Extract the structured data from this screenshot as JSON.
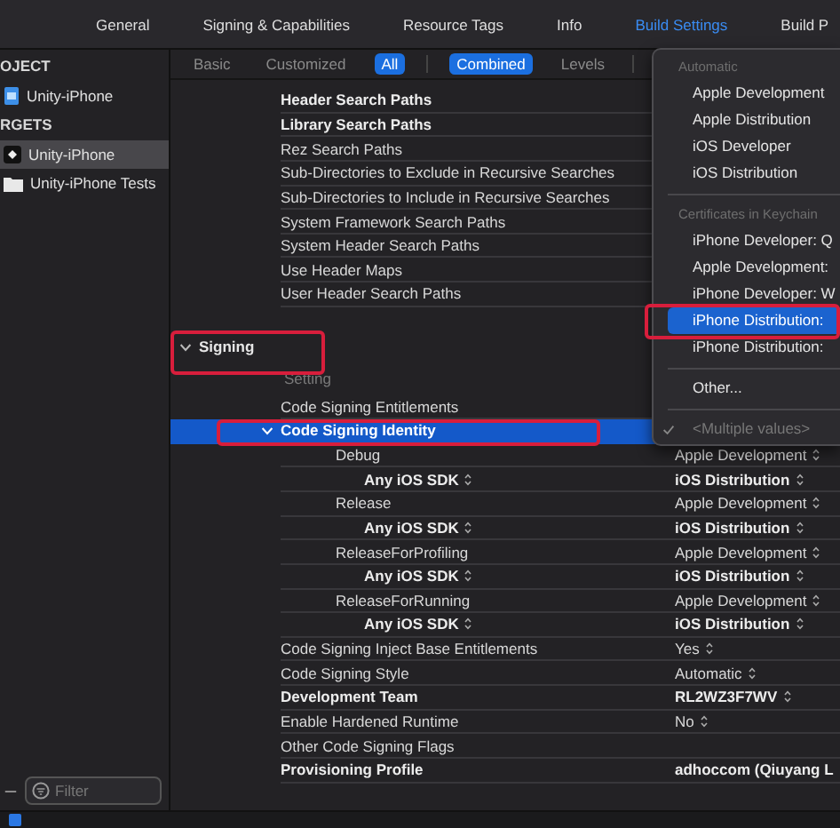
{
  "tabs": [
    {
      "label": "General",
      "selected": false
    },
    {
      "label": "Signing & Capabilities",
      "selected": false
    },
    {
      "label": "Resource Tags",
      "selected": false
    },
    {
      "label": "Info",
      "selected": false
    },
    {
      "label": "Build Settings",
      "selected": true
    },
    {
      "label": "Build P",
      "selected": false
    }
  ],
  "sidebar": {
    "sections": [
      {
        "title": "OJECT",
        "items": [
          {
            "label": "Unity-iPhone",
            "kind": "project",
            "selected": false
          }
        ]
      },
      {
        "title": "RGETS",
        "items": [
          {
            "label": "Unity-iPhone",
            "kind": "app",
            "selected": true
          },
          {
            "label": "Unity-iPhone Tests",
            "kind": "tests",
            "selected": false
          }
        ]
      }
    ],
    "filter": {
      "placeholder": "Filter"
    }
  },
  "filter_bar": {
    "scopes": [
      {
        "label": "Basic",
        "selected": false
      },
      {
        "label": "Customized",
        "selected": false
      },
      {
        "label": "All",
        "selected": true
      }
    ],
    "views": [
      {
        "label": "Combined",
        "selected": true
      },
      {
        "label": "Levels",
        "selected": false
      }
    ]
  },
  "settings": [
    {
      "kind": "row",
      "name": "Header Search Paths",
      "customized": true,
      "selected": false
    },
    {
      "kind": "row",
      "name": "Library Search Paths",
      "customized": true,
      "selected": false
    },
    {
      "kind": "row",
      "name": "Rez Search Paths",
      "customized": false,
      "selected": false
    },
    {
      "kind": "row",
      "name": "Sub-Directories to Exclude in Recursive Searches",
      "customized": false,
      "selected": false
    },
    {
      "kind": "row",
      "name": "Sub-Directories to Include in Recursive Searches",
      "customized": false,
      "selected": false
    },
    {
      "kind": "row",
      "name": "System Framework Search Paths",
      "customized": false,
      "selected": false
    },
    {
      "kind": "row",
      "name": "System Header Search Paths",
      "customized": false,
      "selected": false
    },
    {
      "kind": "row",
      "name": "Use Header Maps",
      "customized": false,
      "selected": false
    },
    {
      "kind": "row",
      "name": "User Header Search Paths",
      "customized": false,
      "selected": false
    },
    {
      "kind": "blank"
    },
    {
      "kind": "section",
      "name": "Signing",
      "expanded": true,
      "marked": true
    },
    {
      "kind": "header",
      "name": "Setting"
    },
    {
      "kind": "row",
      "name": "Code Signing Entitlements",
      "customized": false,
      "selected": false
    },
    {
      "kind": "row",
      "name": "Code Signing Identity",
      "customized": true,
      "selected": true,
      "marked": true,
      "expanded": true,
      "children": [
        {
          "kind": "row",
          "name": "Debug",
          "value": "Apple Development",
          "popup": true,
          "customized": false,
          "selected": false,
          "children": [
            {
              "kind": "row",
              "name": "Any iOS SDK",
              "name_popup": true,
              "value": "iOS Distribution",
              "popup": true,
              "customized": true,
              "selected": false
            }
          ]
        },
        {
          "kind": "row",
          "name": "Release",
          "value": "Apple Development",
          "popup": true,
          "customized": false,
          "selected": false,
          "children": [
            {
              "kind": "row",
              "name": "Any iOS SDK",
              "name_popup": true,
              "value": "iOS Distribution",
              "popup": true,
              "customized": true,
              "selected": false
            }
          ]
        },
        {
          "kind": "row",
          "name": "ReleaseForProfiling",
          "value": "Apple Development",
          "popup": true,
          "customized": false,
          "selected": false,
          "children": [
            {
              "kind": "row",
              "name": "Any iOS SDK",
              "name_popup": true,
              "value": "iOS Distribution",
              "popup": true,
              "customized": true,
              "selected": false
            }
          ]
        },
        {
          "kind": "row",
          "name": "ReleaseForRunning",
          "value": "Apple Development",
          "popup": true,
          "customized": false,
          "selected": false,
          "children": [
            {
              "kind": "row",
              "name": "Any iOS SDK",
              "name_popup": true,
              "value": "iOS Distribution",
              "popup": true,
              "customized": true,
              "selected": false
            }
          ]
        }
      ]
    },
    {
      "kind": "row",
      "name": "Code Signing Inject Base Entitlements",
      "value": "Yes",
      "popup": true,
      "customized": false,
      "selected": false
    },
    {
      "kind": "row",
      "name": "Code Signing Style",
      "value": "Automatic",
      "popup": true,
      "customized": false,
      "selected": false
    },
    {
      "kind": "row",
      "name": "Development Team",
      "value": "RL2WZ3F7WV",
      "popup": true,
      "customized": true,
      "selected": false
    },
    {
      "kind": "row",
      "name": "Enable Hardened Runtime",
      "value": "No",
      "popup": true,
      "customized": false,
      "selected": false
    },
    {
      "kind": "row",
      "name": "Other Code Signing Flags",
      "customized": false,
      "selected": false
    },
    {
      "kind": "row",
      "name": "Provisioning Profile",
      "value": "adhoccom (Qiuyang L",
      "customized": true,
      "selected": false
    }
  ],
  "menu": {
    "items": [
      {
        "kind": "header",
        "label": "Automatic"
      },
      {
        "kind": "item",
        "label": "Apple Development",
        "selected": false
      },
      {
        "kind": "item",
        "label": "Apple Distribution",
        "selected": false
      },
      {
        "kind": "item",
        "label": "iOS Developer",
        "selected": false
      },
      {
        "kind": "item",
        "label": "iOS Distribution",
        "selected": false
      },
      {
        "kind": "separator"
      },
      {
        "kind": "header",
        "label": "Certificates in Keychain"
      },
      {
        "kind": "item",
        "label": "iPhone Developer: Q",
        "selected": false
      },
      {
        "kind": "item",
        "label": "Apple Development:",
        "selected": false
      },
      {
        "kind": "item",
        "label": "iPhone Developer: W",
        "selected": false
      },
      {
        "kind": "item",
        "label": "iPhone Distribution:",
        "selected": true,
        "marked": true
      },
      {
        "kind": "item",
        "label": "iPhone Distribution:",
        "selected": false
      },
      {
        "kind": "separator"
      },
      {
        "kind": "item",
        "label": "Other...",
        "selected": false
      },
      {
        "kind": "separator"
      },
      {
        "kind": "item",
        "label": "<Multiple values>",
        "selected": false,
        "checked": true,
        "disabled": true
      }
    ]
  }
}
